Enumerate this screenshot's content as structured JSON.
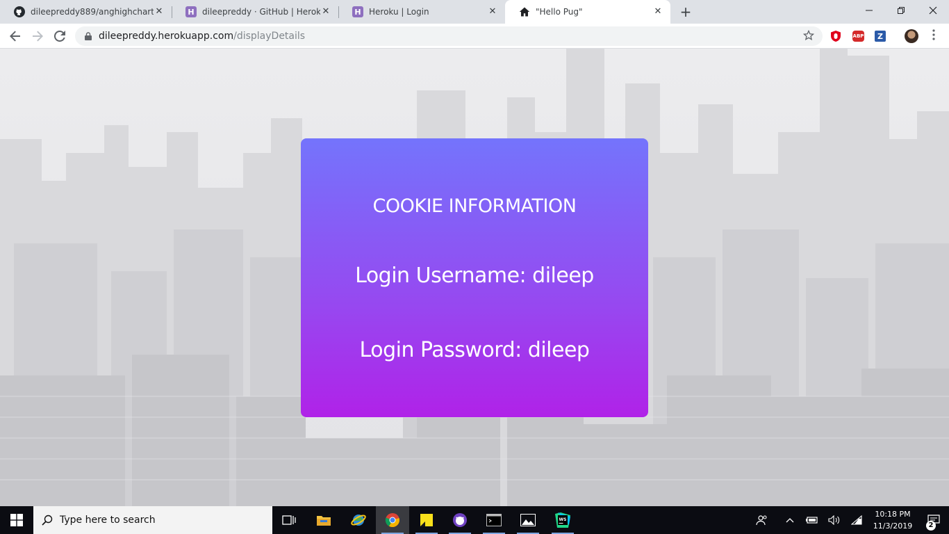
{
  "browser": {
    "tabs": [
      {
        "title": "dileepreddy889/anghighchart",
        "favicon": "github-icon",
        "active": false
      },
      {
        "title": "dileepreddy · GitHub | Heroku",
        "favicon": "heroku-icon",
        "active": false
      },
      {
        "title": "Heroku | Login",
        "favicon": "heroku-icon",
        "active": false
      },
      {
        "title": "\"Hello Pug\"",
        "favicon": "home-icon",
        "active": true
      }
    ],
    "new_tab_symbol": "+",
    "heroku_letter": "H",
    "close_symbol": "✕",
    "url_host": "dileepreddy.herokuapp.com",
    "url_path": "/displayDetails",
    "extensions": [
      {
        "name": "ublock-icon",
        "label": "",
        "color": "#e0001b"
      },
      {
        "name": "adblock-plus-icon",
        "label": "ABP",
        "color": "#d42a2a"
      },
      {
        "name": "zotero-icon",
        "label": "Z",
        "color": "#2b5aa8"
      }
    ]
  },
  "page": {
    "card_title": "COOKIE INFORMATION",
    "username_line": "Login Username: dileep",
    "password_line": "Login Password: dileep",
    "gradient_top": "#7474fc",
    "gradient_bottom": "#b022e8"
  },
  "taskbar": {
    "search_placeholder": "Type here to search",
    "time": "10:18 PM",
    "date": "11/3/2019",
    "notification_count": "2"
  }
}
